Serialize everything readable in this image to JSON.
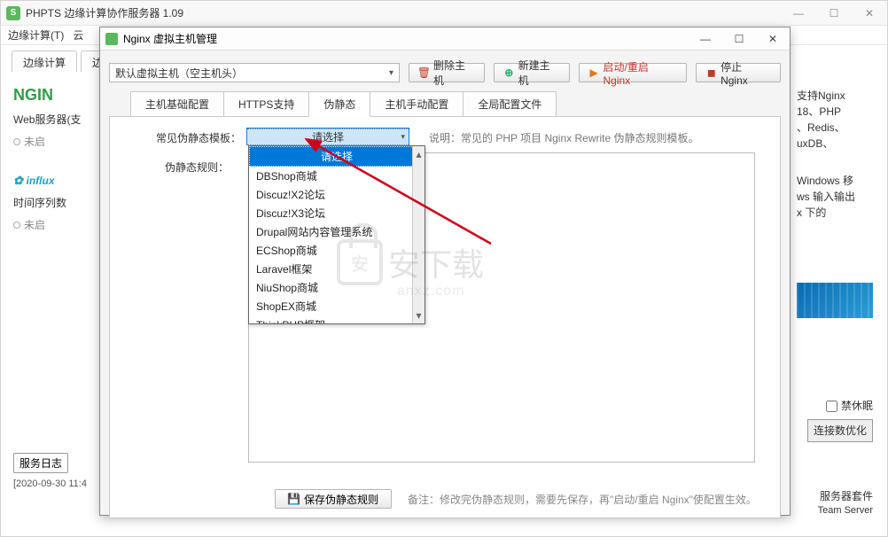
{
  "main_window": {
    "title": "PHPTS 边缘计算协作服务器 1.09",
    "menu": [
      "边缘计算(T)",
      "云"
    ]
  },
  "outer_tabs": [
    "边缘计算",
    "边"
  ],
  "left_panel": {
    "nginx_logo": "NGIN",
    "web_server_label": "Web服务器(支",
    "not_started1": "未启",
    "influx": "influx",
    "timeseries_label": "时间序列数",
    "not_started2": "未启"
  },
  "log": {
    "title": "服务日志",
    "timestamp": "[2020-09-30 11:4"
  },
  "right": {
    "l1": "支持Nginx",
    "l2": "18、PHP",
    "l3": "、Redis、",
    "l4": "uxDB、",
    "w1": "Windows 移",
    "w2": "ws 输入输出",
    "w3": "x 下的",
    "hibernate": "禁休眠",
    "optimize": "连接数优化",
    "svc1": "服务器套件",
    "svc2": "Team Server"
  },
  "dialog": {
    "title": "Nginx 虚拟主机管理",
    "vhost_value": "默认虚拟主机（空主机头）",
    "buttons": {
      "delete": "删除主机",
      "new": "新建主机",
      "restart": "启动/重启 Nginx",
      "stop": "停止 Nginx"
    },
    "tabs": [
      "主机基础配置",
      "HTTPS支持",
      "伪静态",
      "主机手动配置",
      "全局配置文件"
    ],
    "form": {
      "template_label": "常见伪静态模板：",
      "template_value": "请选择",
      "template_hint": "说明：常见的 PHP 项目 Nginx Rewrite 伪静态规则模板。",
      "rules_label": "伪静态规则："
    },
    "dropdown_items": [
      "请选择",
      "DBShop商城",
      "Discuz!X2论坛",
      "Discuz!X3论坛",
      "Drupal网站内容管理系统",
      "ECShop商城",
      "Laravel框架",
      "NiuShop商城",
      "ShopEX商城",
      "ThinkPHP框架"
    ],
    "save_label": "保存伪静态规则",
    "save_note": "备注：修改完伪静态规则，需要先保存，再\"启动/重启 Nginx\"使配置生效。"
  },
  "watermark": {
    "big": "安下载",
    "small": "anxz.com"
  }
}
